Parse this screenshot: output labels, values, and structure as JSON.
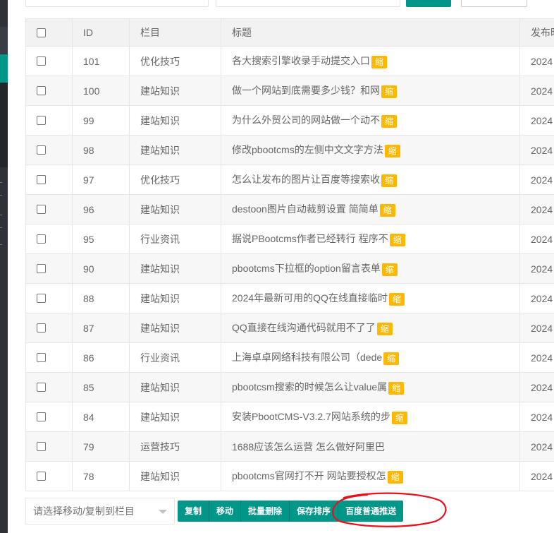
{
  "table": {
    "headers": {
      "id": "ID",
      "category": "栏目",
      "title": "标题",
      "date": "发布时"
    },
    "tag_label": "缩",
    "rows": [
      {
        "id": "101",
        "category": "优化技巧",
        "title": "各大搜索引擎收录手动提交入口",
        "tag": "缩",
        "date": "2024"
      },
      {
        "id": "100",
        "category": "建站知识",
        "title": "做一个网站到底需要多少钱？和网",
        "tag": "缩",
        "date": "2024"
      },
      {
        "id": "99",
        "category": "建站知识",
        "title": "为什么外贸公司的网站做一个动不",
        "tag": "缩",
        "date": "2024"
      },
      {
        "id": "98",
        "category": "建站知识",
        "title": "修改pbootcms的左侧中文文字方法",
        "tag": "缩",
        "date": "2024"
      },
      {
        "id": "97",
        "category": "优化技巧",
        "title": "怎么让发布的图片让百度等搜索收",
        "tag": "缩",
        "date": "2024"
      },
      {
        "id": "96",
        "category": "建站知识",
        "title": "destoon图片自动裁剪设置 简简单",
        "tag": "缩",
        "date": "2024"
      },
      {
        "id": "95",
        "category": "行业资讯",
        "title": "据说PBootcms作者已经转行 程序不",
        "tag": "缩",
        "date": "2024"
      },
      {
        "id": "90",
        "category": "建站知识",
        "title": "pbootcms下拉框的option留言表单",
        "tag": "缩",
        "date": "2024"
      },
      {
        "id": "88",
        "category": "建站知识",
        "title": "2024年最新可用的QQ在线直接临时",
        "tag": "缩",
        "date": "2024"
      },
      {
        "id": "87",
        "category": "建站知识",
        "title": "QQ直接在线沟通代码就用不了了",
        "tag": "缩",
        "date": "2024"
      },
      {
        "id": "86",
        "category": "行业资讯",
        "title": "上海卓卓网络科技有限公司（dede",
        "tag": "缩",
        "date": "2024"
      },
      {
        "id": "85",
        "category": "建站知识",
        "title": "pbootcsm搜索的时候怎么让value属",
        "tag": "缩",
        "date": "2024"
      },
      {
        "id": "84",
        "category": "建站知识",
        "title": "安装PbootCMS-V3.2.7网站系统的步",
        "tag": "缩",
        "date": "2024"
      },
      {
        "id": "79",
        "category": "运营技巧",
        "title": "1688应该怎么运营 怎么做好阿里巴",
        "tag": "",
        "date": "2024"
      },
      {
        "id": "78",
        "category": "建站知识",
        "title": "pbootcms官网打不开 网站要授权怎",
        "tag": "缩",
        "date": "2024"
      }
    ]
  },
  "footer": {
    "move_select_placeholder": "请选择移动/复制到栏目",
    "buttons": [
      "复制",
      "移动",
      "批量删除",
      "保存排序",
      "百度普通推送"
    ]
  },
  "colors": {
    "primary": "#009688",
    "tag": "#ffb800",
    "annotation": "#e8101a"
  }
}
